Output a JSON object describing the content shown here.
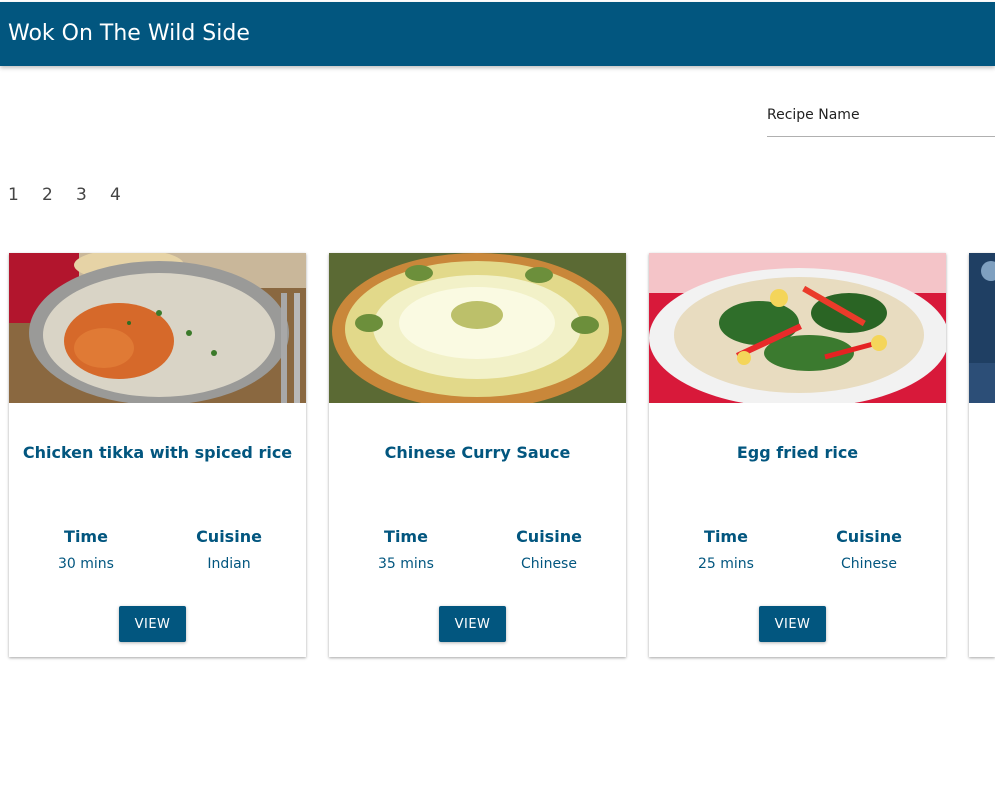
{
  "header": {
    "title": "Wok On The Wild Side"
  },
  "search": {
    "placeholder": "Recipe Name",
    "value": ""
  },
  "pagination": [
    "1",
    "2",
    "3",
    "4"
  ],
  "cards": [
    {
      "title": "Chicken tikka with spiced rice",
      "time_label": "Time",
      "time": "30 mins",
      "cuisine_label": "Cuisine",
      "cuisine": "Indian",
      "button": "VIEW"
    },
    {
      "title": "Chinese Curry Sauce",
      "time_label": "Time",
      "time": "35 mins",
      "cuisine_label": "Cuisine",
      "cuisine": "Chinese",
      "button": "VIEW"
    },
    {
      "title": "Egg fried rice",
      "time_label": "Time",
      "time": "25 mins",
      "cuisine_label": "Cuisine",
      "cuisine": "Chinese",
      "button": "VIEW"
    }
  ],
  "colors": {
    "brand": "#02567f",
    "text_on_brand": "#ffffff"
  }
}
